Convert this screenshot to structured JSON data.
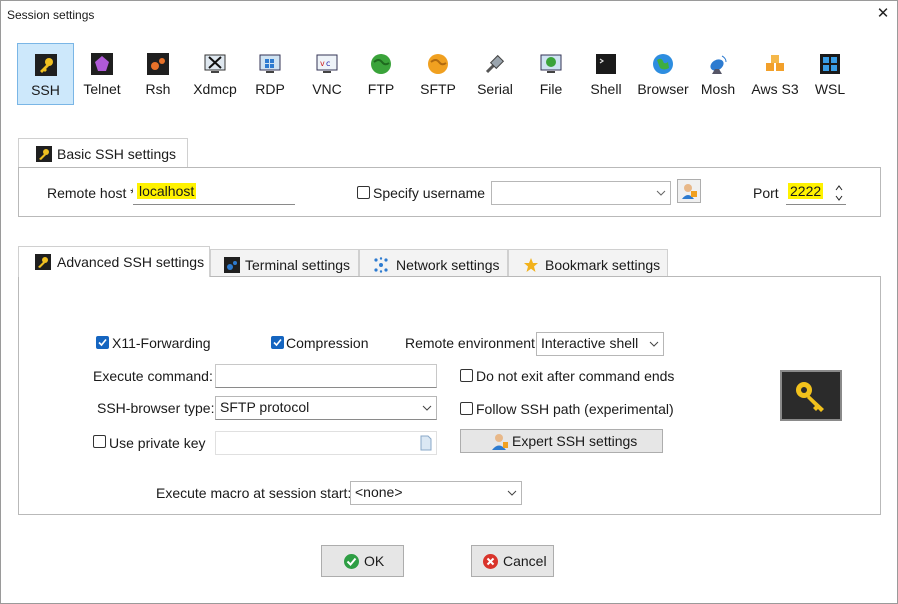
{
  "window": {
    "title": "Session settings",
    "close_glyph": "✕"
  },
  "protocols": [
    {
      "label": "SSH",
      "icon": "ssh-key-icon",
      "selected": true
    },
    {
      "label": "Telnet",
      "icon": "telnet-icon"
    },
    {
      "label": "Rsh",
      "icon": "rsh-icon"
    },
    {
      "label": "Xdmcp",
      "icon": "xdmcp-icon"
    },
    {
      "label": "RDP",
      "icon": "rdp-icon"
    },
    {
      "label": "VNC",
      "icon": "vnc-icon"
    },
    {
      "label": "FTP",
      "icon": "ftp-icon"
    },
    {
      "label": "SFTP",
      "icon": "sftp-icon"
    },
    {
      "label": "Serial",
      "icon": "serial-icon"
    },
    {
      "label": "File",
      "icon": "file-icon"
    },
    {
      "label": "Shell",
      "icon": "shell-icon"
    },
    {
      "label": "Browser",
      "icon": "browser-icon"
    },
    {
      "label": "Mosh",
      "icon": "mosh-icon"
    },
    {
      "label": "Aws S3",
      "icon": "aws-s3-icon"
    },
    {
      "label": "WSL",
      "icon": "wsl-icon"
    }
  ],
  "basic": {
    "tab_label": "Basic SSH settings",
    "remote_host_label": "Remote host *",
    "remote_host_value": "localhost",
    "specify_username_label": "Specify username",
    "specify_username_checked": false,
    "username_value": "",
    "port_label": "Port",
    "port_value": "2222"
  },
  "tabs": [
    {
      "label": "Advanced SSH settings",
      "active": true
    },
    {
      "label": "Terminal settings"
    },
    {
      "label": "Network settings"
    },
    {
      "label": "Bookmark settings"
    }
  ],
  "advanced": {
    "x11_label": "X11-Forwarding",
    "x11_checked": true,
    "compression_label": "Compression",
    "compression_checked": true,
    "remote_env_label": "Remote environment:",
    "remote_env_value": "Interactive shell",
    "execute_command_label": "Execute command:",
    "execute_command_value": "",
    "do_not_exit_label": "Do not exit after command ends",
    "do_not_exit_checked": false,
    "browser_type_label": "SSH-browser type:",
    "browser_type_value": "SFTP protocol",
    "follow_path_label": "Follow SSH path (experimental)",
    "follow_path_checked": false,
    "private_key_label": "Use private key",
    "private_key_checked": false,
    "expert_button_label": "Expert SSH settings",
    "macro_label": "Execute macro at session start:",
    "macro_value": "<none>"
  },
  "buttons": {
    "ok_label": "OK",
    "cancel_label": "Cancel"
  },
  "colors": {
    "selection_bg": "#cde8fb",
    "highlight": "#fff200",
    "checkbox_on": "#1565c0",
    "ok_green": "#2e9e44",
    "cancel_red": "#d9342b"
  }
}
